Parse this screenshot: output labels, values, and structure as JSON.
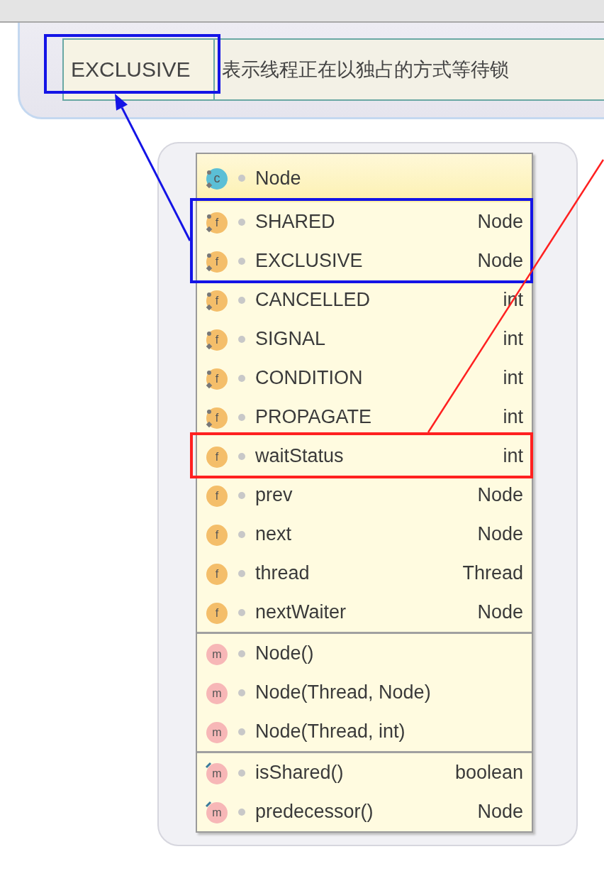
{
  "description_table": {
    "rows": [
      {
        "cells": [
          {
            "text": "EXCLUSIVE",
            "boxed": true,
            "color": "#1414e6"
          },
          {
            "text": "表示线程正在以独占的方式等待锁",
            "boxed": false
          }
        ]
      }
    ]
  },
  "class_node": {
    "header": {
      "kind": "class",
      "icon": "c",
      "name": "Node"
    },
    "sections": [
      {
        "members": [
          {
            "kind": "static-field",
            "icon": "f",
            "name": "SHARED",
            "type": "Node",
            "boxed": true,
            "color": "#1414e6"
          },
          {
            "kind": "static-field",
            "icon": "f",
            "name": "EXCLUSIVE",
            "type": "Node",
            "boxed": true,
            "color": "#1414e6"
          },
          {
            "kind": "static-field",
            "icon": "f",
            "name": "CANCELLED",
            "type": "int",
            "boxed": false
          },
          {
            "kind": "static-field",
            "icon": "f",
            "name": "SIGNAL",
            "type": "int",
            "boxed": false
          },
          {
            "kind": "static-field",
            "icon": "f",
            "name": "CONDITION",
            "type": "int",
            "boxed": false
          },
          {
            "kind": "static-field",
            "icon": "f",
            "name": "PROPAGATE",
            "type": "int",
            "boxed": false
          },
          {
            "kind": "field",
            "icon": "f",
            "name": "waitStatus",
            "type": "int",
            "boxed": true,
            "color": "#ff2020"
          },
          {
            "kind": "field",
            "icon": "f",
            "name": "prev",
            "type": "Node",
            "boxed": false
          },
          {
            "kind": "field",
            "icon": "f",
            "name": "next",
            "type": "Node",
            "boxed": false
          },
          {
            "kind": "field",
            "icon": "f",
            "name": "thread",
            "type": "Thread",
            "boxed": false
          },
          {
            "kind": "field",
            "icon": "f",
            "name": "nextWaiter",
            "type": "Node",
            "boxed": false
          }
        ]
      },
      {
        "members": [
          {
            "kind": "constructor",
            "icon": "m",
            "name": "Node()",
            "boxed": false
          },
          {
            "kind": "constructor",
            "icon": "m",
            "name": "Node(Thread, Node)",
            "boxed": false
          },
          {
            "kind": "constructor",
            "icon": "m",
            "name": "Node(Thread, int)",
            "boxed": false
          }
        ]
      },
      {
        "members": [
          {
            "kind": "method",
            "icon": "m",
            "name": "isShared()",
            "type": "boolean",
            "boxed": false
          },
          {
            "kind": "method",
            "icon": "m",
            "name": "predecessor()",
            "type": "Node",
            "boxed": false
          }
        ]
      }
    ]
  },
  "annotations": [
    {
      "kind": "arrow",
      "color": "#1414e6"
    },
    {
      "kind": "line",
      "color": "#ff2020"
    }
  ]
}
